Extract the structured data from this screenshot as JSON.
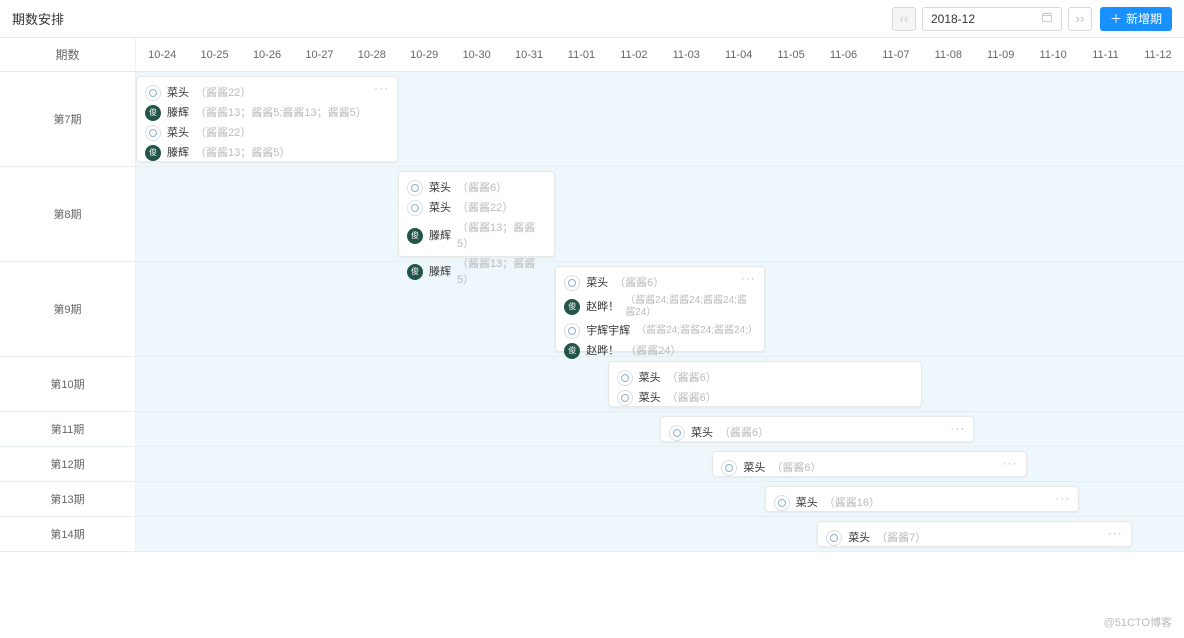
{
  "toolbar": {
    "title": "期数安排",
    "date": "2018-12",
    "add_label": "新增期"
  },
  "header": {
    "label": "期数",
    "days": [
      "10-24",
      "10-25",
      "10-26",
      "10-27",
      "10-28",
      "10-29",
      "10-30",
      "10-31",
      "11-01",
      "11-02",
      "11-03",
      "11-04",
      "11-05",
      "11-06",
      "11-07",
      "11-08",
      "11-09",
      "11-10",
      "11-11",
      "11-12"
    ]
  },
  "rows": [
    {
      "label": "第7期",
      "card": {
        "start": 0,
        "span": 5,
        "show_more": true,
        "items": [
          {
            "avatar": "white",
            "name": "菜头",
            "meta": "（酱酱22）"
          },
          {
            "avatar": "dark",
            "glyph": "俊",
            "name": "滕辉",
            "meta": "（酱酱13；酱酱5;酱酱13；酱酱5）"
          },
          {
            "avatar": "white",
            "name": "菜头",
            "meta": "（酱酱22）"
          },
          {
            "avatar": "dark",
            "glyph": "俊",
            "name": "滕辉",
            "meta": "（酱酱13；酱酱5）"
          }
        ]
      }
    },
    {
      "label": "第8期",
      "card": {
        "start": 5,
        "span": 3,
        "show_more": false,
        "items": [
          {
            "avatar": "white",
            "name": "菜头",
            "meta": "（酱酱6）"
          },
          {
            "avatar": "white",
            "name": "菜头",
            "meta": "（酱酱22）"
          },
          {
            "avatar": "dark",
            "glyph": "俊",
            "name": "滕辉",
            "meta": "（酱酱13；酱酱5）"
          },
          {
            "avatar": "dark",
            "glyph": "俊",
            "name": "滕辉",
            "meta": "（酱酱13；酱酱5）"
          }
        ]
      }
    },
    {
      "label": "第9期",
      "card": {
        "start": 8,
        "span": 4,
        "show_more": true,
        "items": [
          {
            "avatar": "white",
            "name": "菜头",
            "meta": "（酱酱6）"
          },
          {
            "avatar": "dark",
            "glyph": "俊",
            "name": "赵晔！",
            "meta": "（酱酱24;酱酱24;酱酱24;酱酱24）",
            "wrap": true
          },
          {
            "avatar": "white",
            "name": "宇辉宇辉",
            "meta": "（酱酱24;酱酱24;酱酱24;）",
            "wrap": true
          },
          {
            "avatar": "dark",
            "glyph": "俊",
            "name": "赵晔！",
            "meta": "（酱酱24）"
          }
        ]
      }
    },
    {
      "label": "第10期",
      "card": {
        "start": 9,
        "span": 6,
        "show_more": false,
        "items": [
          {
            "avatar": "white",
            "name": "菜头",
            "meta": "（酱酱6）"
          },
          {
            "avatar": "white",
            "name": "菜头",
            "meta": "（酱酱6）"
          }
        ]
      }
    },
    {
      "label": "第11期",
      "card": {
        "start": 10,
        "span": 6,
        "show_more": true,
        "items": [
          {
            "avatar": "white",
            "name": "菜头",
            "meta": "（酱酱6）"
          }
        ]
      }
    },
    {
      "label": "第12期",
      "card": {
        "start": 11,
        "span": 6,
        "show_more": true,
        "items": [
          {
            "avatar": "white",
            "name": "菜头",
            "meta": "（酱酱6）"
          }
        ]
      }
    },
    {
      "label": "第13期",
      "card": {
        "start": 12,
        "span": 6,
        "show_more": true,
        "items": [
          {
            "avatar": "white",
            "name": "菜头",
            "meta": "（酱酱16）"
          }
        ]
      }
    },
    {
      "label": "第14期",
      "card": {
        "start": 13,
        "span": 6,
        "show_more": true,
        "items": [
          {
            "avatar": "white",
            "name": "菜头",
            "meta": "（酱酱7）"
          }
        ]
      }
    }
  ],
  "watermark": "@51CTO博客"
}
